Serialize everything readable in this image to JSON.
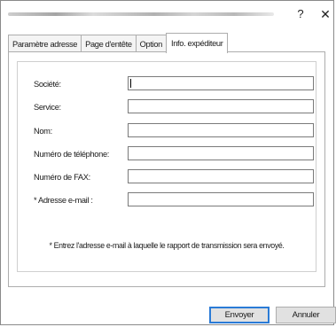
{
  "window": {
    "help_label": "?",
    "close_label": "✕"
  },
  "tabs": [
    {
      "label": "Paramètre adresse"
    },
    {
      "label": "Page d'entête"
    },
    {
      "label": "Option"
    },
    {
      "label": "Info. expéditeur"
    }
  ],
  "active_tab": "Info. expéditeur",
  "form": {
    "company_label": "Société:",
    "company_value": "",
    "department_label": "Service:",
    "department_value": "",
    "name_label": "Nom:",
    "name_value": "",
    "phone_label": "Numéro de téléphone:",
    "phone_value": "",
    "fax_label": "Numéro de FAX:",
    "fax_value": "",
    "email_label": "* Adresse e-mail :",
    "email_value": ""
  },
  "note": "* Entrez l'adresse e-mail à laquelle le rapport de transmission sera envoyé.",
  "buttons": {
    "send_label": "Envoyer",
    "cancel_label": "Annuler"
  },
  "colors": {
    "accent_focus": "#2a7bd6"
  }
}
